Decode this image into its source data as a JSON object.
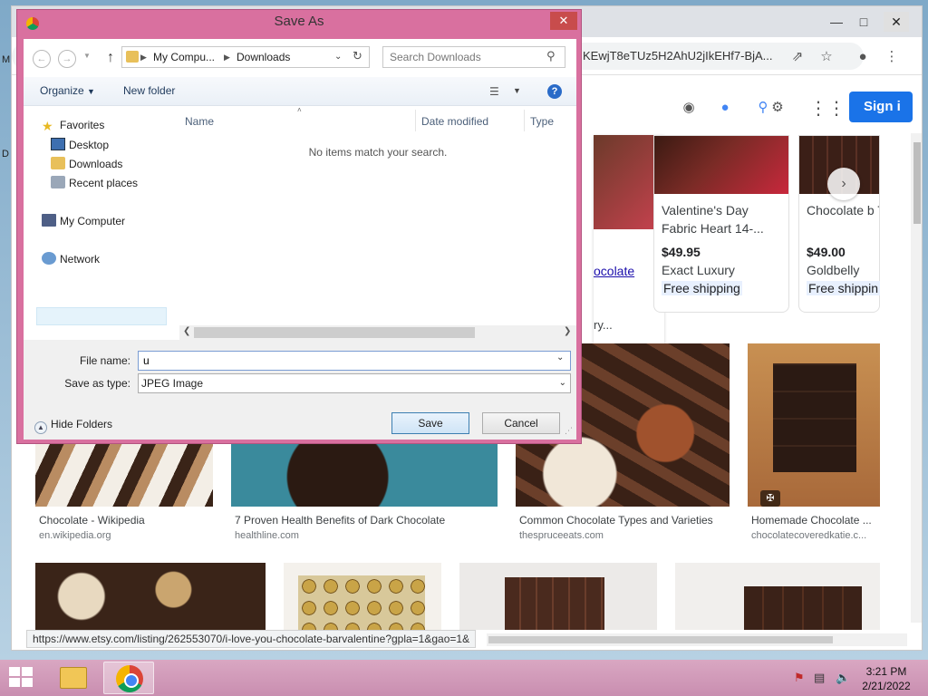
{
  "chrome": {
    "omnibox_text": "KEwjT8eTUz5H2AhU2jIkEHf7-BjA...",
    "sign_in_label": "Sign i",
    "status_url": "https://www.etsy.com/listing/262553070/i-love-you-chocolate-barvalentine?gpla=1&gao=1&"
  },
  "shopping": [
    {
      "title": "Valentine's Day Fabric Heart 14-...",
      "price": "$49.95",
      "store": "Exact Luxury",
      "shipping": "Free shipping"
    },
    {
      "title": "Chocolate b Thomas Ke",
      "price": "$49.00",
      "store": "Goldbelly",
      "shipping": "Free shippin"
    }
  ],
  "partial": {
    "link": "ocolate",
    "text": "ry..."
  },
  "images": [
    {
      "caption": "Chocolate - Wikipedia",
      "source": "en.wikipedia.org"
    },
    {
      "caption": "7 Proven Health Benefits of Dark Chocolate",
      "source": "healthline.com"
    },
    {
      "caption": "Common Chocolate Types and Varieties",
      "source": "thespruceeats.com"
    },
    {
      "caption": "Homemade Chocolate ...",
      "source": "chocolatecoveredkatie.c..."
    }
  ],
  "dialog": {
    "title": "Save As",
    "address": {
      "seg1": "My Compu...",
      "seg2": "Downloads"
    },
    "search_placeholder": "Search Downloads",
    "organize_label": "Organize",
    "new_folder_label": "New folder",
    "nav": {
      "favorites": "Favorites",
      "desktop": "Desktop",
      "downloads": "Downloads",
      "recent": "Recent places",
      "computer": "My Computer",
      "network": "Network"
    },
    "columns": {
      "name": "Name",
      "date": "Date modified",
      "type": "Type"
    },
    "empty_message": "No items match your search.",
    "file_name_label": "File name:",
    "file_name_value": "u",
    "save_type_label": "Save as type:",
    "save_type_value": "JPEG Image",
    "hide_folders_label": "Hide Folders",
    "save_label": "Save",
    "cancel_label": "Cancel"
  },
  "clock": {
    "time": "3:21 PM",
    "date": "2/21/2022"
  }
}
